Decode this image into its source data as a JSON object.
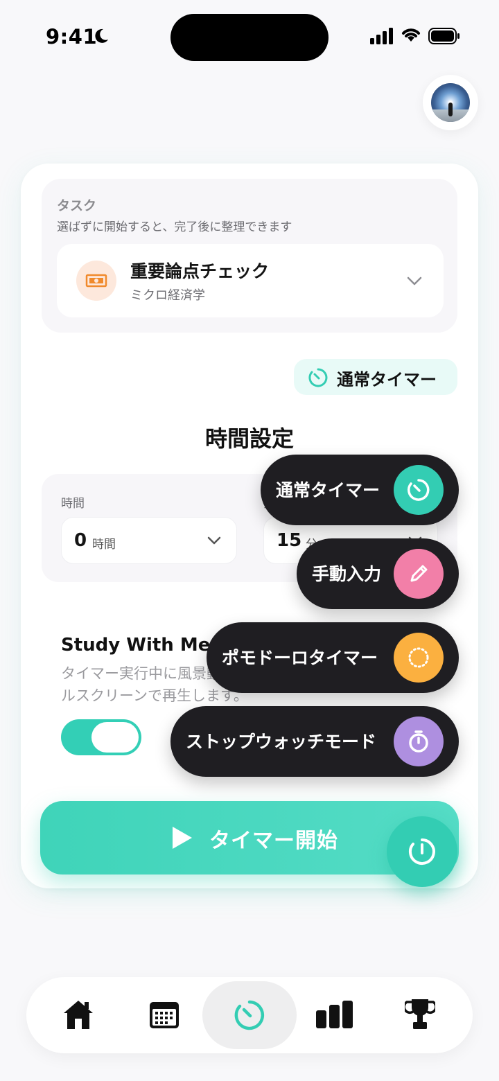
{
  "status_bar": {
    "time": "9:41"
  },
  "task": {
    "title": "タスク",
    "subtitle": "選ばずに開始すると、完了後に整理できます",
    "selected_name": "重要論点チェック",
    "selected_subject": "ミクロ経済学",
    "icon": "money-icon"
  },
  "mode_chip": {
    "label": "通常タイマー"
  },
  "time_settings": {
    "title": "時間設定",
    "hours_label": "時間",
    "hours_value": "0",
    "hours_unit": "時間",
    "minutes_label": "分",
    "minutes_value": "15",
    "minutes_unit": "分"
  },
  "study_with_me": {
    "title": "Study With Me モード",
    "description": "タイマー実行中に風景動画と BGM をフルスクリーンで再生します。",
    "enabled": true
  },
  "start_button": {
    "label": "タイマー開始"
  },
  "speed_dial": [
    {
      "label": "通常タイマー",
      "icon": "timer-icon",
      "color": "#33cdb3"
    },
    {
      "label": "手動入力",
      "icon": "pencil-icon",
      "color": "#f27fa8"
    },
    {
      "label": "ポモドーロタイマー",
      "icon": "dotted-circle-icon",
      "color": "#fbb040"
    },
    {
      "label": "ストップウォッチモード",
      "icon": "stopwatch-icon",
      "color": "#ae8fe0"
    }
  ],
  "bottom_nav": [
    {
      "name": "home",
      "icon": "home-icon"
    },
    {
      "name": "calendar",
      "icon": "calendar-icon"
    },
    {
      "name": "timer",
      "icon": "timer-icon",
      "active": true
    },
    {
      "name": "stats",
      "icon": "bar-chart-icon"
    },
    {
      "name": "ranking",
      "icon": "trophy-icon"
    }
  ],
  "colors": {
    "accent": "#33cdb3",
    "dark": "#1f1e22",
    "task_icon": "#f08a2c"
  }
}
